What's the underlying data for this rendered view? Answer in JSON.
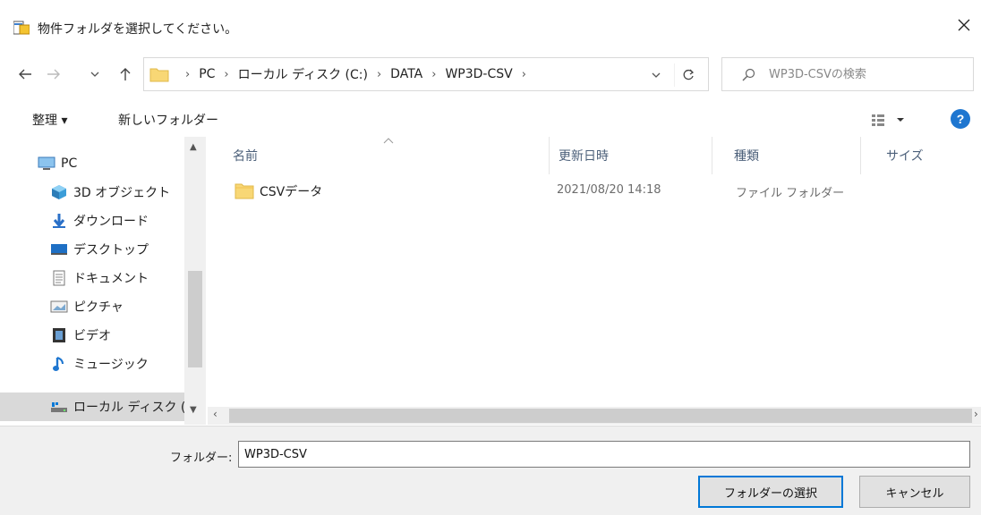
{
  "window": {
    "title": "物件フォルダを選択してください。",
    "close_icon": "close-icon"
  },
  "navigation": {
    "back_icon": "arrow-left-icon",
    "forward_icon": "arrow-right-icon",
    "recent_icon": "chevron-down-icon",
    "up_icon": "arrow-up-icon",
    "breadcrumbs": [
      "PC",
      "ローカル ディスク (C:)",
      "DATA",
      "WP3D-CSV"
    ],
    "search_placeholder": "WP3D-CSVの検索"
  },
  "toolbar": {
    "organize_label": "整理 ▾",
    "new_folder_label": "新しいフォルダー",
    "help_label": "?"
  },
  "sidebar": {
    "items": [
      {
        "label": "PC",
        "icon": "computer-icon"
      },
      {
        "label": "3D オブジェクト",
        "icon": "3d-objects-icon"
      },
      {
        "label": "ダウンロード",
        "icon": "download-icon"
      },
      {
        "label": "デスクトップ",
        "icon": "desktop-icon"
      },
      {
        "label": "ドキュメント",
        "icon": "document-icon"
      },
      {
        "label": "ピクチャ",
        "icon": "picture-icon"
      },
      {
        "label": "ビデオ",
        "icon": "video-icon"
      },
      {
        "label": "ミュージック",
        "icon": "music-icon"
      },
      {
        "label": "ローカル ディスク (C",
        "icon": "local-disk-icon",
        "selected": true
      }
    ]
  },
  "file_list": {
    "columns": [
      "名前",
      "更新日時",
      "種類",
      "サイズ"
    ],
    "rows": [
      {
        "name": "CSVデータ",
        "modified": "2021/08/20 14:18",
        "type": "ファイル フォルダー",
        "size": ""
      }
    ]
  },
  "footer": {
    "folder_label": "フォルダー:",
    "folder_value": "WP3D-CSV",
    "select_button": "フォルダーの選択",
    "cancel_button": "キャンセル"
  },
  "colors": {
    "accent": "#0078d7",
    "folder": "#f8d775",
    "selection": "#d9d9d9"
  }
}
